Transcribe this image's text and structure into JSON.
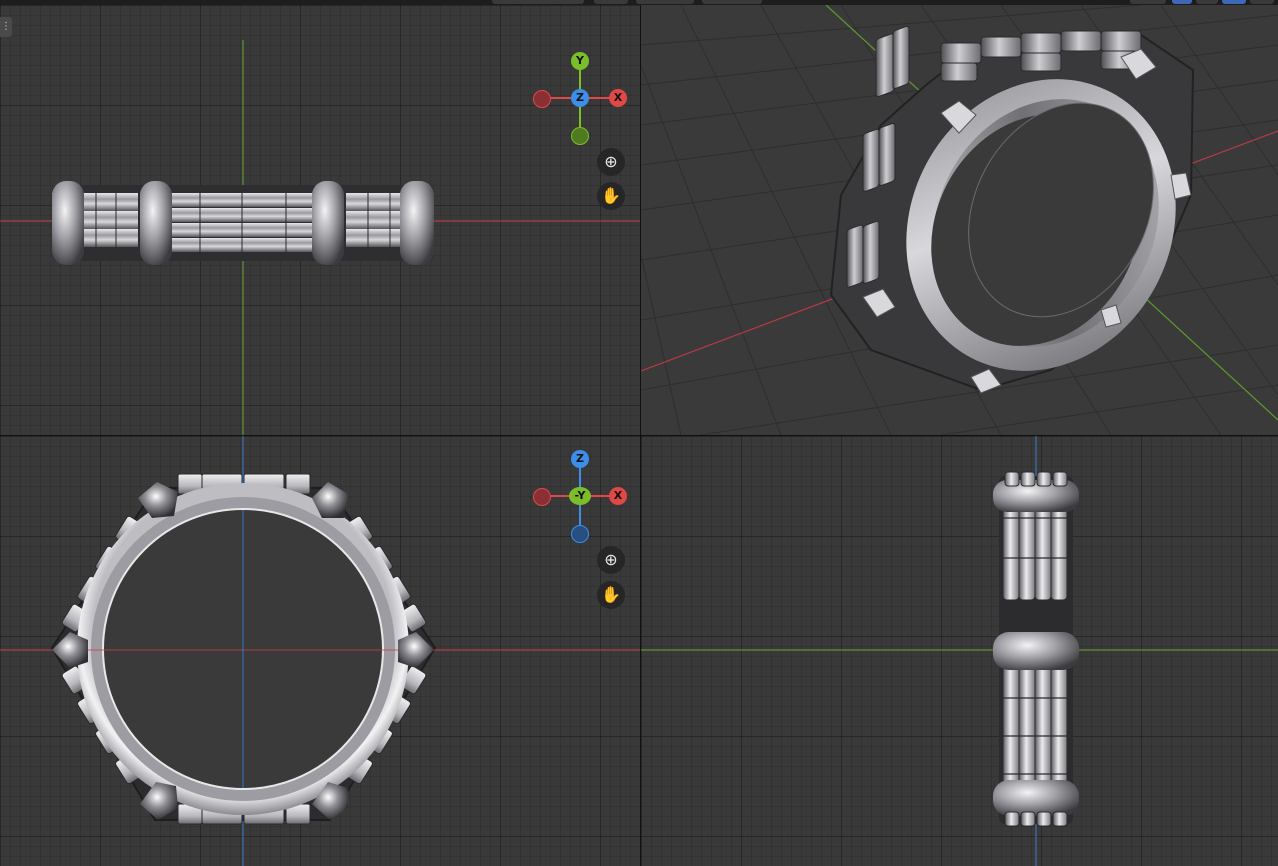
{
  "axis_colors": {
    "x": "#e04848",
    "y": "#7bbe2a",
    "z": "#3c8ee8"
  },
  "gizmo_front": {
    "up_label": "Y",
    "center_label": "Z",
    "right_label": "X"
  },
  "gizmo_side": {
    "up_label": "Z",
    "center_label": "-Y",
    "right_label": "X"
  },
  "icons": {
    "zoom": "zoom-in-icon",
    "pan": "hand-pan-icon",
    "corner": "view-options-icon"
  }
}
